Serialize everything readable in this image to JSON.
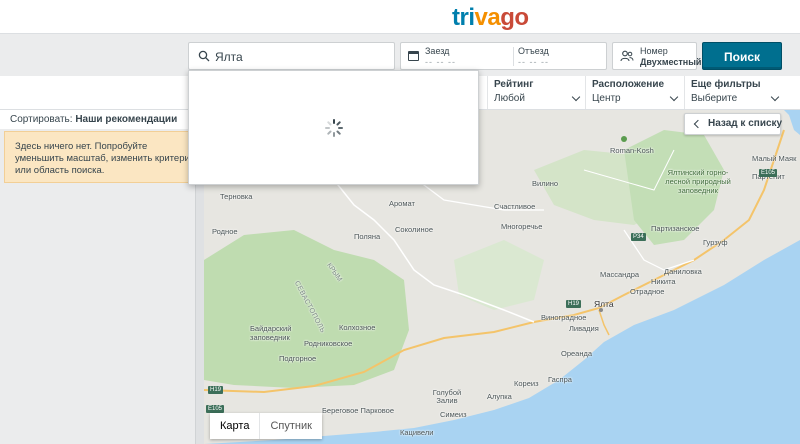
{
  "header": {
    "logo_part1": "tri",
    "logo_part2": "va",
    "logo_part3": "go"
  },
  "search": {
    "value": "Ялта",
    "icon": "search-icon"
  },
  "dates": {
    "checkin_label": "Заезд",
    "checkin_value": "-- -- --",
    "checkout_label": "Отъезд",
    "checkout_value": "-- -- --",
    "icon": "calendar-icon"
  },
  "room": {
    "label": "Номер",
    "value": "Двухместный",
    "icon": "room-icon"
  },
  "search_button": {
    "label": "Поиск"
  },
  "filters": [
    {
      "title": "Рейтинг",
      "value": "Любой"
    },
    {
      "title": "Расположение",
      "value": "Центр"
    },
    {
      "title": "Еще фильтры",
      "value": "Выберите"
    }
  ],
  "sidebar": {
    "sort_prefix": "Сортировать:",
    "sort_value": "Наши рекомендации",
    "empty_message": "Здесь ничего нет. Попробуйте уменьшить масштаб, изменить критерии или область поиска."
  },
  "map": {
    "back_button": "Назад к списку",
    "map_type_active": "Карта",
    "map_type_inactive": "Спутник",
    "labels": {
      "roman_kosh": "Roman-Kosh",
      "maly_mayak": "Малый Маяк",
      "partenit": "Партенит",
      "preserve": "Ялтинский горно-лесной природный заповедник",
      "partizanskoe": "Партизанское",
      "gurzuf": "Гурзуф",
      "ternovka": "Терновка",
      "rodnoe": "Родное",
      "aromat": "Аромат",
      "schastlivoe": "Счастливое",
      "vilino": "Вилино",
      "polyana": "Поляна",
      "sokolinoe": "Соколиное",
      "mnogorechie": "Многоречье",
      "sevastopol": "СЕВАСТОПОЛЬ",
      "krym": "КРЫМ",
      "massandra": "Массандра",
      "danilovka": "Даниловка",
      "nikita": "Никита",
      "otradnoe": "Отрадное",
      "yalta": "Ялта",
      "baydar": "Байдарский заповедник",
      "kolhoznoe": "Колхозное",
      "rodnikovskoe": "Родниковское",
      "vinogradnoe": "Виноградное",
      "livadia": "Ливадия",
      "oreanda": "Ореанда",
      "podgornoe": "Подгорное",
      "koreiz": "Кореиз",
      "gaspra": "Гаспра",
      "golubaya": "Голубой Залив",
      "alupka": "Алупка",
      "beregovoe": "Береговое Парковое",
      "simeiz": "Симеиз",
      "katsiveli": "Кацивели",
      "r1": "E105",
      "r2": "P34",
      "r3": "H19",
      "r4": "H19",
      "r5": "E105"
    }
  },
  "colors": {
    "brand_blue": "#007fad",
    "brand_orange": "#f48f00",
    "brand_red": "#c94a38",
    "button": "#006f8f",
    "warning_bg": "#fbe6c2"
  }
}
